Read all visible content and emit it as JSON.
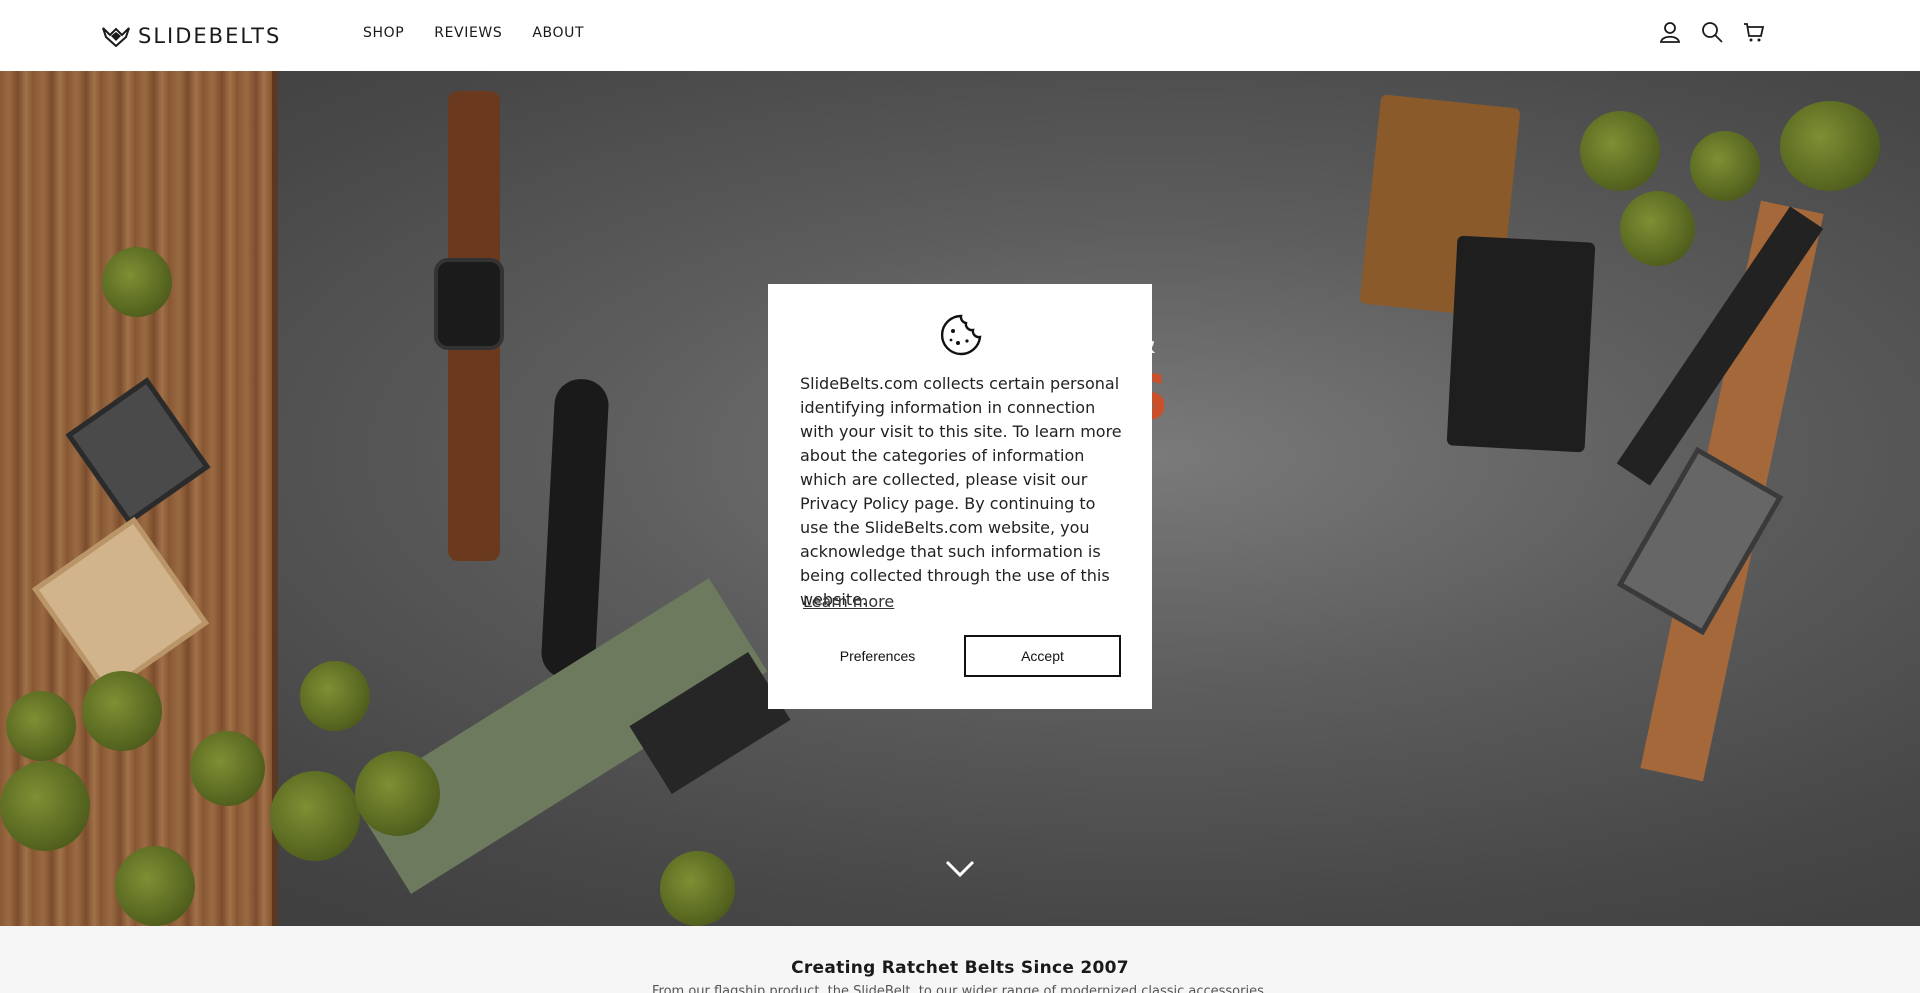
{
  "header": {
    "logo_text": "SLIDEBELTS",
    "nav": [
      "SHOP",
      "REVIEWS",
      "ABOUT"
    ],
    "icons": [
      "account-icon",
      "search-icon",
      "cart-icon"
    ]
  },
  "hero": {
    "heading_line1": "S &",
    "heading_line2": "TS"
  },
  "cookie_modal": {
    "icon": "cookie-icon",
    "text": "SlideBelts.com collects certain personal identifying information in connection with your visit to this site. To learn more about the categories of information which are collected, please visit our Privacy Policy page. By continuing to use the SlideBelts.com website, you acknowledge that such information is being collected through the use of this website.",
    "learn_more": "Learn more",
    "preferences_label": "Preferences",
    "accept_label": "Accept"
  },
  "section": {
    "title": "Creating Ratchet Belts Since 2007",
    "subtitle": "From our flagship product, the SlideBelt, to our wider range of modernized classic accessories,"
  },
  "colors": {
    "accent": "#c9502b",
    "header_bg": "#ffffff",
    "section_bg": "#f6f6f6"
  }
}
